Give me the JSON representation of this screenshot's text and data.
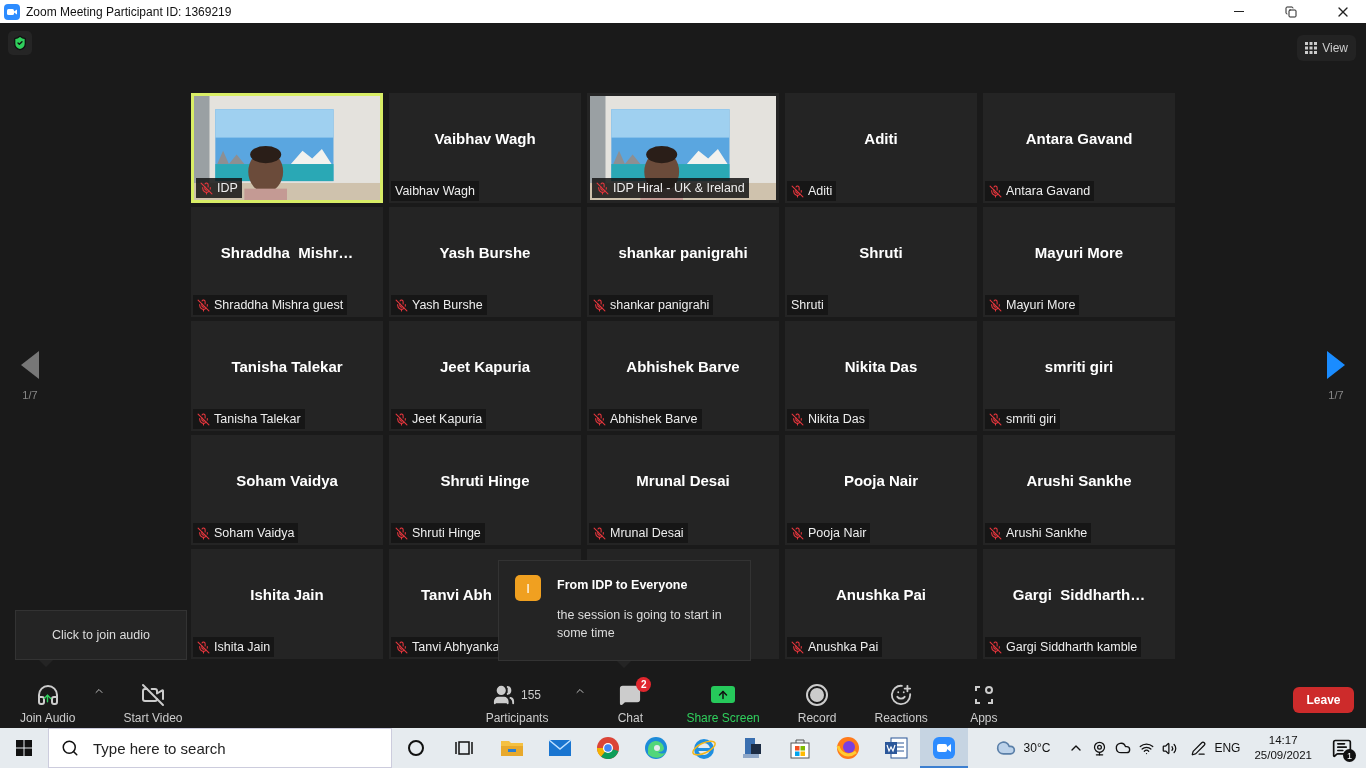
{
  "window": {
    "title": "Zoom Meeting Participant ID: 1369219"
  },
  "top_bar": {
    "view_button": "View"
  },
  "pager": {
    "previous": {
      "label": "1/7",
      "enabled": false
    },
    "next": {
      "label": "1/7",
      "enabled": true
    }
  },
  "tiles": [
    {
      "kind": "video",
      "label": "IDP",
      "muted": true,
      "speaking": true
    },
    {
      "kind": "name",
      "name": "Vaibhav Wagh",
      "label": "Vaibhav Wagh",
      "muted": false,
      "speaking": false
    },
    {
      "kind": "video",
      "label": "IDP Hiral - UK & Ireland",
      "muted": true,
      "speaking": false
    },
    {
      "kind": "name",
      "name": "Aditi",
      "label": "Aditi",
      "muted": true,
      "speaking": false
    },
    {
      "kind": "name",
      "name": "Antara Gavand",
      "label": "Antara Gavand",
      "muted": true,
      "speaking": false
    },
    {
      "kind": "name",
      "name": "Shraddha  Mishr…",
      "label": "Shraddha Mishra guest",
      "muted": true,
      "speaking": false
    },
    {
      "kind": "name",
      "name": "Yash Burshe",
      "label": "Yash Burshe",
      "muted": true,
      "speaking": false
    },
    {
      "kind": "name",
      "name": "shankar panigrahi",
      "label": "shankar panigrahi",
      "muted": true,
      "speaking": false
    },
    {
      "kind": "name",
      "name": "Shruti",
      "label": "Shruti",
      "muted": false,
      "speaking": false
    },
    {
      "kind": "name",
      "name": "Mayuri More",
      "label": "Mayuri More",
      "muted": true,
      "speaking": false
    },
    {
      "kind": "name",
      "name": "Tanisha Talekar",
      "label": "Tanisha Talekar",
      "muted": true,
      "speaking": false
    },
    {
      "kind": "name",
      "name": "Jeet Kapuria",
      "label": "Jeet Kapuria",
      "muted": true,
      "speaking": false
    },
    {
      "kind": "name",
      "name": "Abhishek Barve",
      "label": "Abhishek Barve",
      "muted": true,
      "speaking": false
    },
    {
      "kind": "name",
      "name": "Nikita Das",
      "label": "Nikita Das",
      "muted": true,
      "speaking": false
    },
    {
      "kind": "name",
      "name": "smriti giri",
      "label": "smriti giri",
      "muted": true,
      "speaking": false
    },
    {
      "kind": "name",
      "name": "Soham Vaidya",
      "label": "Soham Vaidya",
      "muted": true,
      "speaking": false
    },
    {
      "kind": "name",
      "name": "Shruti Hinge",
      "label": "Shruti Hinge",
      "muted": true,
      "speaking": false
    },
    {
      "kind": "name",
      "name": "Mrunal Desai",
      "label": "Mrunal Desai",
      "muted": true,
      "speaking": false
    },
    {
      "kind": "name",
      "name": "Pooja Nair",
      "label": "Pooja Nair",
      "muted": true,
      "speaking": false
    },
    {
      "kind": "name",
      "name": "Arushi Sankhe",
      "label": "Arushi Sankhe",
      "muted": true,
      "speaking": false
    },
    {
      "kind": "name",
      "name": "Ishita Jain",
      "label": "Ishita Jain",
      "muted": true,
      "speaking": false
    },
    {
      "kind": "name",
      "name": "Tanvi Abh",
      "label": "Tanvi Abhyanka",
      "muted": true,
      "speaking": false,
      "covered": true
    },
    {
      "kind": "empty"
    },
    {
      "kind": "name",
      "name": "Anushka Pai",
      "label": "Anushka Pai",
      "muted": true,
      "speaking": false
    },
    {
      "kind": "name",
      "name": "Gargi  Siddharth…",
      "label": "Gargi Siddharth kamble",
      "muted": true,
      "speaking": false
    }
  ],
  "tooltip": {
    "text": "Click to join audio"
  },
  "chat_popup": {
    "avatar": "I",
    "title": "From IDP to Everyone",
    "message": "the session is going to start in some time"
  },
  "toolbar": {
    "items": [
      {
        "kind": "audio",
        "label": "Join Audio",
        "menu": true
      },
      {
        "kind": "video",
        "label": "Start Video"
      },
      {
        "kind": "participants",
        "label": "Participants",
        "count": "155",
        "menu": true
      },
      {
        "kind": "chat",
        "label": "Chat",
        "badge": "2"
      },
      {
        "kind": "share",
        "label": "Share Screen"
      },
      {
        "kind": "record",
        "label": "Record"
      },
      {
        "kind": "reactions",
        "label": "Reactions"
      },
      {
        "kind": "apps",
        "label": "Apps"
      }
    ],
    "leave": "Leave"
  },
  "taskbar": {
    "search_placeholder": "Type here to search",
    "apps": [
      {
        "kind": "circle",
        "active": false
      },
      {
        "kind": "taskview",
        "active": false
      },
      {
        "kind": "folder",
        "active": false
      },
      {
        "kind": "mail",
        "active": false
      },
      {
        "kind": "browser-a",
        "active": false
      },
      {
        "kind": "browser-b",
        "active": false
      },
      {
        "kind": "browser-c",
        "active": false
      },
      {
        "kind": "tool",
        "active": false
      },
      {
        "kind": "store",
        "active": false
      },
      {
        "kind": "browser-d",
        "active": false
      },
      {
        "kind": "document",
        "active": false
      },
      {
        "kind": "meeting",
        "active": true
      }
    ],
    "weather": "30°C",
    "language": "ENG",
    "time": "14:17",
    "date": "25/09/2021",
    "notifications": "1"
  }
}
